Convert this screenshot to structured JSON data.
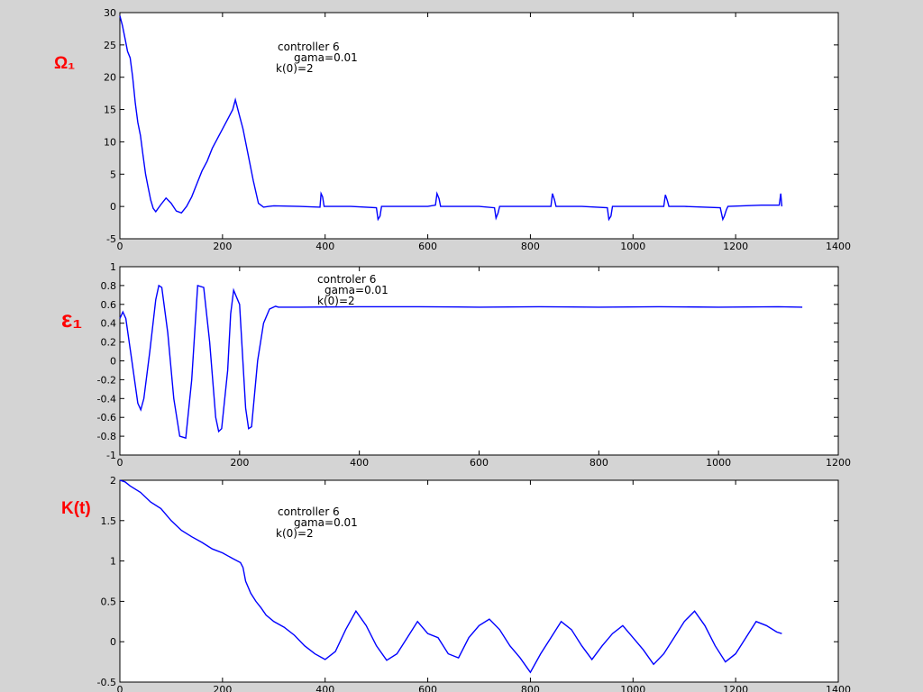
{
  "chart_data": [
    {
      "type": "line",
      "ylabel": "Ω₁",
      "xlim": [
        0,
        1400
      ],
      "ylim": [
        -5,
        30
      ],
      "xticks": [
        "0",
        "200",
        "400",
        "600",
        "800",
        "1000",
        "1200",
        "1400"
      ],
      "yticks": [
        "30",
        "25",
        "20",
        "15",
        "10",
        "5",
        "0",
        "-5"
      ],
      "annotation": [
        "controller 6",
        "gama=0.01",
        "k(0)=2"
      ],
      "color": "#0000ff",
      "grid": false,
      "series": [
        {
          "x": [
            0,
            5,
            10,
            15,
            20,
            25,
            30,
            35,
            40,
            45,
            50,
            55,
            60,
            65,
            70,
            80,
            90,
            100,
            110,
            120,
            130,
            140,
            150,
            160,
            170,
            180,
            190,
            200,
            210,
            220,
            225,
            230,
            240,
            250,
            260,
            270,
            280,
            290,
            300,
            350,
            390,
            392,
            395,
            398,
            400,
            450,
            500,
            503,
            507,
            510,
            515,
            550,
            600,
            615,
            618,
            622,
            625,
            650,
            700,
            730,
            733,
            737,
            740,
            750,
            800,
            840,
            843,
            847,
            850,
            900,
            950,
            953,
            957,
            960,
            1000,
            1060,
            1063,
            1067,
            1070,
            1100,
            1170,
            1175,
            1178,
            1182,
            1185,
            1250,
            1285,
            1288,
            1290
          ],
          "y": [
            29.5,
            28,
            26,
            24,
            23,
            20,
            16,
            13,
            11,
            8,
            5,
            3,
            1,
            -0.3,
            -0.8,
            0.3,
            1.3,
            0.5,
            -0.7,
            -1.0,
            0,
            1.5,
            3.5,
            5.5,
            7,
            9,
            10.5,
            12,
            13.5,
            15,
            16.5,
            15,
            12,
            8,
            4,
            0.5,
            -0.1,
            0,
            0.1,
            0,
            -0.1,
            2,
            1.5,
            0,
            0,
            0,
            -0.2,
            -2,
            -1.5,
            0,
            0,
            0,
            0,
            0.2,
            2,
            1.2,
            0,
            0,
            0,
            -0.2,
            -1.8,
            -1,
            0,
            0,
            0,
            0,
            2,
            1,
            0,
            0,
            -0.2,
            -2,
            -1.5,
            0,
            0,
            0,
            1.8,
            0.9,
            0,
            0,
            -0.2,
            -2,
            -1.5,
            -0.5,
            0,
            0.2,
            0.2,
            2,
            0
          ]
        }
      ]
    },
    {
      "type": "line",
      "ylabel": "ε₁",
      "xlim": [
        0,
        1200
      ],
      "ylim": [
        -1,
        1
      ],
      "xticks": [
        "0",
        "200",
        "400",
        "600",
        "800",
        "1000",
        "1200"
      ],
      "yticks": [
        "1",
        "0.8",
        "0.6",
        "0.4",
        "0.2",
        "0",
        "-0.2",
        "-0.4",
        "-0.6",
        "-0.8",
        "-1"
      ],
      "annotation": [
        "controler 6",
        "gama=0.01",
        "k(0)=2"
      ],
      "color": "#0000ff",
      "grid": false,
      "series": [
        {
          "x": [
            0,
            5,
            10,
            20,
            30,
            35,
            40,
            50,
            60,
            65,
            70,
            80,
            90,
            100,
            110,
            120,
            125,
            130,
            140,
            150,
            160,
            165,
            170,
            180,
            185,
            190,
            200,
            210,
            215,
            220,
            230,
            240,
            250,
            260,
            265,
            270,
            300,
            400,
            500,
            600,
            700,
            800,
            900,
            1000,
            1100,
            1140
          ],
          "y": [
            0.45,
            0.52,
            0.45,
            0,
            -0.45,
            -0.52,
            -0.4,
            0.1,
            0.65,
            0.8,
            0.78,
            0.3,
            -0.4,
            -0.8,
            -0.82,
            -0.2,
            0.3,
            0.8,
            0.78,
            0.2,
            -0.6,
            -0.75,
            -0.72,
            -0.1,
            0.5,
            0.75,
            0.6,
            -0.5,
            -0.72,
            -0.7,
            0,
            0.4,
            0.55,
            0.58,
            0.57,
            0.57,
            0.57,
            0.575,
            0.575,
            0.57,
            0.575,
            0.57,
            0.575,
            0.57,
            0.575,
            0.57
          ]
        }
      ]
    },
    {
      "type": "line",
      "ylabel": "K(t)",
      "xlim": [
        0,
        1400
      ],
      "ylim": [
        -0.5,
        2
      ],
      "xticks": [
        "0",
        "200",
        "400",
        "600",
        "800",
        "1000",
        "1200",
        "1400"
      ],
      "yticks": [
        "2",
        "1.5",
        "1",
        "0.5",
        "0",
        "-0.5"
      ],
      "annotation": [
        "controller 6",
        "gama=0.01",
        "k(0)=2"
      ],
      "color": "#0000ff",
      "grid": false,
      "series": [
        {
          "x": [
            0,
            10,
            20,
            40,
            60,
            80,
            100,
            120,
            140,
            160,
            180,
            200,
            220,
            235,
            240,
            245,
            255,
            265,
            275,
            285,
            300,
            320,
            340,
            360,
            380,
            400,
            420,
            440,
            460,
            480,
            500,
            520,
            540,
            560,
            580,
            600,
            620,
            640,
            660,
            680,
            700,
            720,
            740,
            760,
            780,
            800,
            820,
            840,
            860,
            880,
            900,
            920,
            940,
            960,
            980,
            1000,
            1020,
            1040,
            1060,
            1080,
            1100,
            1120,
            1140,
            1160,
            1180,
            1200,
            1220,
            1240,
            1260,
            1280,
            1290
          ],
          "y": [
            2.0,
            1.98,
            1.93,
            1.85,
            1.73,
            1.65,
            1.5,
            1.38,
            1.3,
            1.23,
            1.15,
            1.1,
            1.03,
            0.98,
            0.92,
            0.75,
            0.6,
            0.5,
            0.42,
            0.33,
            0.25,
            0.18,
            0.08,
            -0.05,
            -0.15,
            -0.22,
            -0.12,
            0.15,
            0.38,
            0.2,
            -0.05,
            -0.23,
            -0.15,
            0.05,
            0.25,
            0.1,
            0.05,
            -0.15,
            -0.2,
            0.05,
            0.2,
            0.28,
            0.15,
            -0.05,
            -0.2,
            -0.38,
            -0.15,
            0.05,
            0.25,
            0.15,
            -0.05,
            -0.22,
            -0.05,
            0.1,
            0.2,
            0.05,
            -0.1,
            -0.28,
            -0.15,
            0.05,
            0.25,
            0.38,
            0.2,
            -0.05,
            -0.25,
            -0.15,
            0.05,
            0.25,
            0.2,
            0.12,
            0.1
          ]
        }
      ]
    }
  ]
}
